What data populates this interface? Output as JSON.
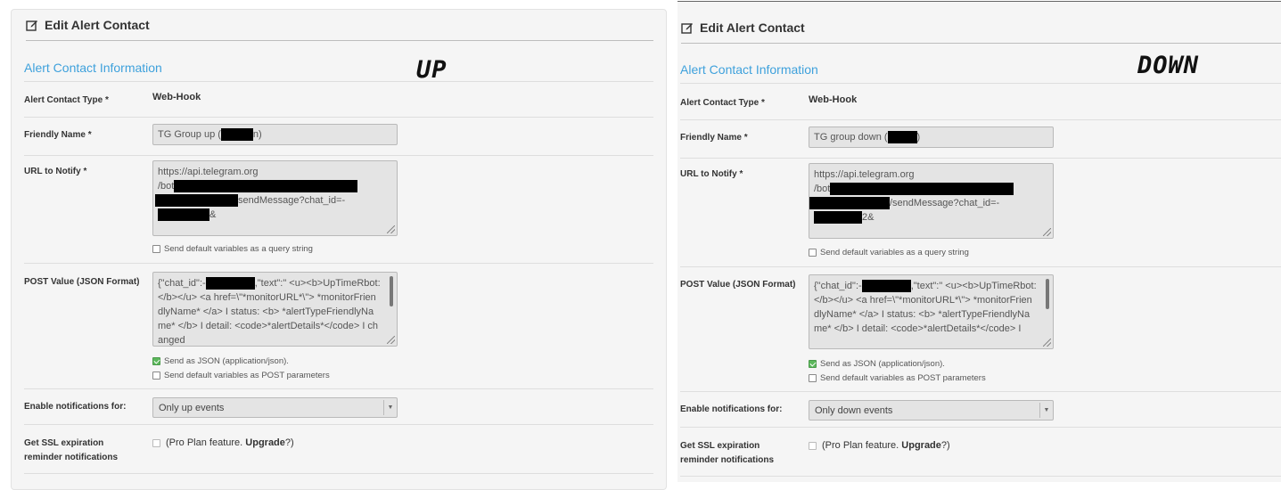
{
  "panels": {
    "up": {
      "title": "Edit Alert Contact",
      "section_heading": "Alert Contact Information",
      "handwritten_label": "UP",
      "type_label": "Alert Contact Type *",
      "type_value": "Web-Hook",
      "name_label": "Friendly Name *",
      "name_prefix": "TG Group up (",
      "name_suffix": "n)",
      "url_label": "URL to Notify *",
      "url_line1": "https://api.telegram.org",
      "url_line2_prefix": "/bot",
      "url_line3_suffix": "sendMessage?chat_id=-",
      "url_line4_suffix": "&",
      "query_string_label": "Send default variables as a query string",
      "post_label": "POST Value (JSON Format)",
      "post_prefix": "{\"chat_id\":-",
      "post_body": ",\"text\":\" <u><b>UpTimeRbot:</b></u> <a href=\\\"*monitorURL*\\\"> *monitorFriendlyName* </a> I status: <b> *alertTypeFriendlyName* </b> I detail: <code>*alertDetails*</code> I changed",
      "send_json_label": "Send as JSON (application/json).",
      "send_post_label": "Send default variables as POST parameters",
      "notif_label": "Enable notifications for:",
      "notif_value": "Only up events",
      "ssl_label_line1": "Get SSL expiration",
      "ssl_label_line2": "reminder notifications",
      "ssl_text_prefix": "(Pro Plan feature. ",
      "ssl_upgrade": "Upgrade",
      "ssl_text_suffix": "?)"
    },
    "down": {
      "title": "Edit Alert Contact",
      "section_heading": "Alert Contact Information",
      "handwritten_label": "DOWN",
      "type_label": "Alert Contact Type *",
      "type_value": "Web-Hook",
      "name_label": "Friendly Name *",
      "name_prefix": "TG group down (",
      "name_suffix": ")",
      "url_label": "URL to Notify *",
      "url_line1": "https://api.telegram.org",
      "url_line2_prefix": "/bot",
      "url_line3_suffix": "/sendMessage?chat_id=-",
      "url_line4_suffix": "2&",
      "query_string_label": "Send default variables as a query string",
      "post_label": "POST Value (JSON Format)",
      "post_prefix": "{\"chat_id\":-",
      "post_body": ",\"text\":\" <u><b>UpTimeRbot:</b></u> <a href=\\\"*monitorURL*\\\"> *monitorFriendlyName* </a> I status: <b> *alertTypeFriendlyName* </b> I detail: <code>*alertDetails*</code> I",
      "send_json_label": "Send as JSON (application/json).",
      "send_post_label": "Send default variables as POST parameters",
      "notif_label": "Enable notifications for:",
      "notif_value": "Only down events",
      "ssl_label_line1": "Get SSL expiration",
      "ssl_label_line2": "reminder notifications",
      "ssl_text_prefix": "(Pro Plan feature. ",
      "ssl_upgrade": "Upgrade",
      "ssl_text_suffix": "?)"
    }
  },
  "colors": {
    "accent": "#3ea1dc",
    "panel_bg": "#f5f5f5",
    "field_bg": "#e4e4e4",
    "checked": "#5cb85c",
    "redaction": "#000000"
  },
  "icons": {
    "title": "edit-icon",
    "select_arrow": "chevron-down-icon"
  }
}
